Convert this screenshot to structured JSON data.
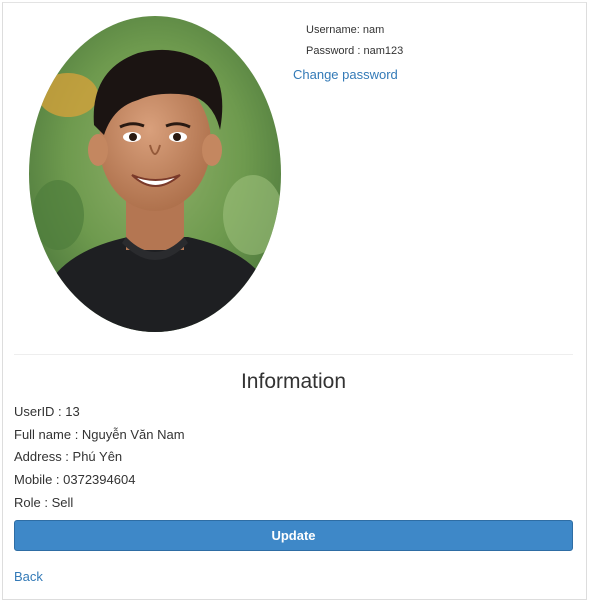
{
  "credentials": {
    "username_text": "Username: nam",
    "password_text": "Password : nam123",
    "change_password_label": "Change password"
  },
  "info": {
    "title": "Information",
    "user_id_text": "UserID : 13",
    "full_name_text": "Full name : Nguyễn Văn Nam",
    "address_text": "Address : Phú Yên",
    "mobile_text": "Mobile : 0372394604",
    "role_text": "Role : Sell"
  },
  "actions": {
    "update_label": "Update",
    "back_label": "Back"
  },
  "colors": {
    "primary_button": "#3e88c8",
    "link": "#337ab7"
  }
}
